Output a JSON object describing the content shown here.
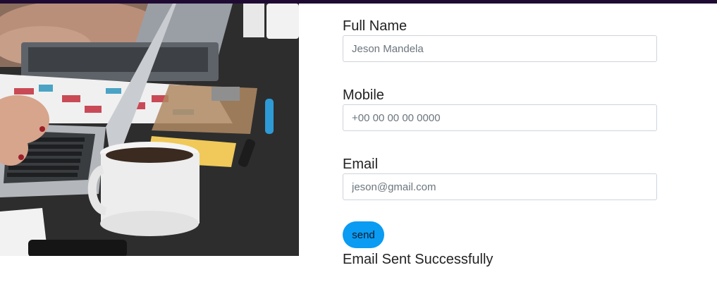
{
  "form": {
    "full_name": {
      "label": "Full Name",
      "placeholder": "Jeson Mandela"
    },
    "mobile": {
      "label": "Mobile",
      "placeholder": "+00 00 00 00 0000"
    },
    "email": {
      "label": "Email",
      "placeholder": "jeson@gmail.com"
    },
    "send_label": "send",
    "status_message": "Email Sent Successfully"
  },
  "colors": {
    "top_bar": "#1f0a33",
    "button": "#0a9bf2",
    "input_border": "#ced4da"
  }
}
